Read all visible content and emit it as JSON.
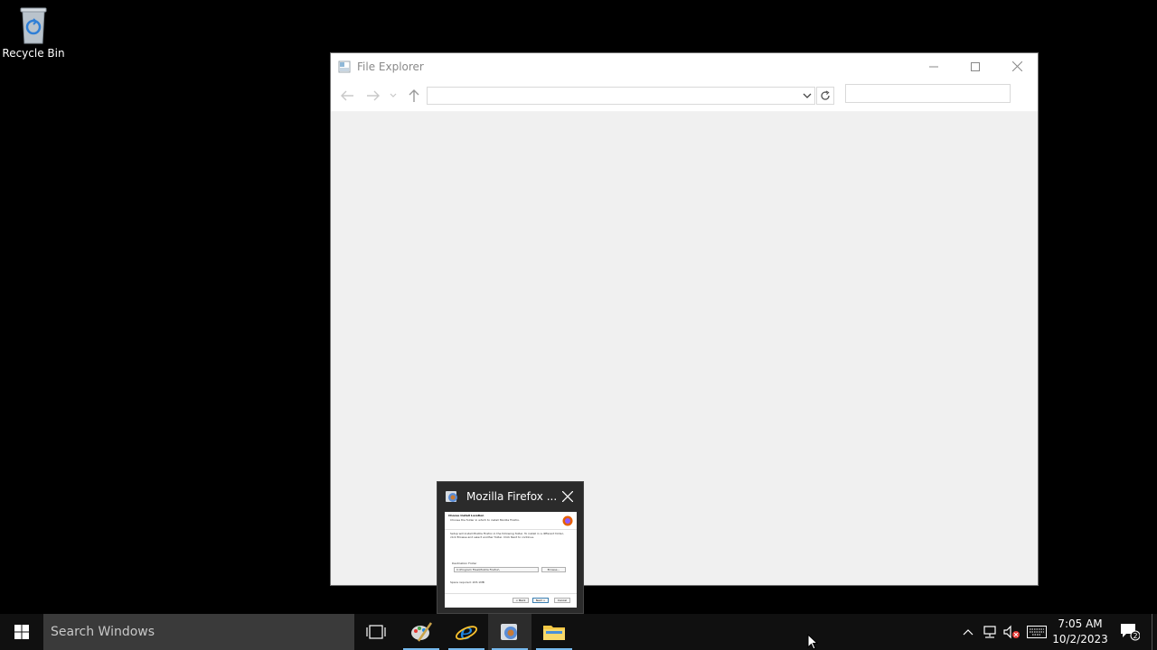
{
  "desktop": {
    "icons": [
      {
        "label": "Recycle Bin",
        "icon": "recycle-bin-icon"
      }
    ]
  },
  "explorer": {
    "title": "File Explorer",
    "address_value": "",
    "search_placeholder": ""
  },
  "preview": {
    "title": "Mozilla Firefox ...",
    "thumbnail": {
      "heading": "Choose Install Location",
      "subheading": "Choose the folder in which to install Mozilla Firefox.",
      "body": "Setup will install Mozilla Firefox in the following folder. To install in a different folder, click Browse and select another folder. Click Next to continue.",
      "folder_label": "Destination Folder",
      "folder_value": "C:\\Program Files\\Mozilla Firefox\\",
      "browse_label": "Browse...",
      "space_label": "Space required: 205.1MB",
      "buttons": [
        "< Back",
        "Next >",
        "Cancel"
      ]
    }
  },
  "taskbar": {
    "search_placeholder": "Search Windows",
    "pinned": [
      {
        "name": "task-view",
        "icon": "task-view-icon"
      },
      {
        "name": "paint",
        "icon": "paint-icon"
      },
      {
        "name": "internet-explorer",
        "icon": "internet-explorer-icon"
      },
      {
        "name": "firefox-installer",
        "icon": "installer-icon"
      },
      {
        "name": "file-explorer",
        "icon": "folder-icon"
      }
    ],
    "tray": {
      "time": "7:05 AM",
      "date": "10/2/2023",
      "notification_count": "2"
    }
  },
  "colors": {
    "desktop_bg": "#000000",
    "taskbar_bg": "#101010",
    "accent": "#76b9ed"
  }
}
